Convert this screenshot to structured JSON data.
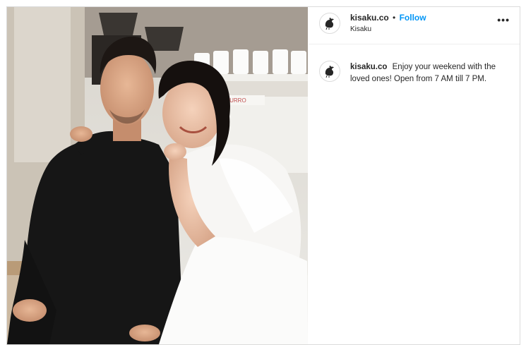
{
  "post": {
    "username": "kisaku.co",
    "separator": "•",
    "follow_label": "Follow",
    "location": "Kisaku",
    "more_label": "•••",
    "caption": "Enjoy your weekend with the loved ones! Open from 7 AM till 7 PM.",
    "logo_icon": "rooster-logo-icon"
  },
  "photo": {
    "sign_text": "AZZURRO",
    "description_icon": "post-photo"
  }
}
